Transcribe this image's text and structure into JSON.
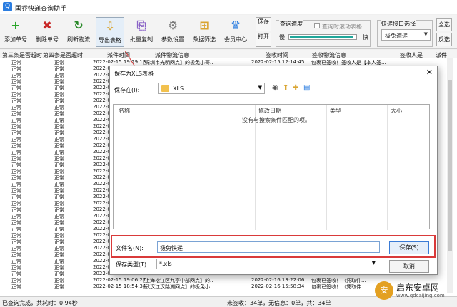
{
  "window": {
    "title": "国乔快递查询助手"
  },
  "toolbar": {
    "buttons": [
      {
        "label": "添加单号",
        "icon": "+",
        "icon_name": "plus-icon",
        "color": "#2aa52a"
      },
      {
        "label": "删除单号",
        "icon": "✖",
        "icon_name": "delete-x-icon",
        "color": "#c82828"
      },
      {
        "label": "刷新物流",
        "icon": "↻",
        "icon_name": "refresh-icon",
        "color": "#2a8a2a"
      },
      {
        "label": "导出表格",
        "icon": "⇩",
        "icon_name": "export-icon",
        "color": "#d9a430"
      },
      {
        "label": "批量复制",
        "icon": "⎘",
        "icon_name": "copy-icon",
        "color": "#8a63c7"
      },
      {
        "label": "参数设置",
        "icon": "⚙",
        "icon_name": "gear-icon",
        "color": "#777777"
      },
      {
        "label": "数据筛选",
        "icon": "⊞",
        "icon_name": "filter-icon",
        "color": "#d9a430"
      },
      {
        "label": "会员中心",
        "icon": "♛",
        "icon_name": "member-icon",
        "color": "#2b7de0"
      }
    ],
    "save": "保存",
    "open": "打开",
    "speed_group": "查询速度",
    "slow": "慢",
    "fast": "快",
    "scroll_checkbox": "查询时滚动表格",
    "speed_level": 0.95,
    "api_group": "快递接口选择",
    "api_selected": "极兔速递",
    "select_all": "全选",
    "invert": "反选"
  },
  "grid": {
    "headers": [
      "第三条是否超时",
      "第四条是否超时",
      "派件时间",
      "派件物流信息",
      "签收时间",
      "签收物流信息",
      "签收人是",
      "派件"
    ],
    "status_normal": "正常",
    "row1": {
      "time": "2022-02-15 19:29:13",
      "info": "【深圳市光明网点】的极兔小哥...",
      "sign_time": "2022-02-15 12:14:45",
      "sign_info": "包裹已签收！签收人是【本人签..."
    },
    "date_prefix": "2022-02-15",
    "row_last2": {
      "time": "2022-02-15 19:06:27",
      "info": "【上海松江区九亭中部网点】的...",
      "sign_time": "2022-02-16 13:22:06",
      "sign_info": "包裹已签收！（凭取件..."
    },
    "row_last": {
      "time": "2022-02-15 18:54:34",
      "info": "【武汉江汉路湖网点】的极兔小...",
      "sign_time": "2022-02-16 15:58:34",
      "sign_info": "包裹已签收！（凭取件..."
    }
  },
  "dialog": {
    "title": "保存为XLS表格",
    "save_in": "保存在(I):",
    "folder": "XLS",
    "col_name": "名称",
    "col_date": "修改日期",
    "col_type": "类型",
    "col_size": "大小",
    "empty": "没有与搜索条件匹配的项。",
    "filename_label": "文件名(N):",
    "filename": "极兔快递",
    "type_label": "保存类型(T):",
    "type_value": "*.xls",
    "save_btn": "保存(S)",
    "cancel_btn": "取消"
  },
  "statusbar": {
    "left": "已查询完成，共耗时：0.94秒",
    "right": "未签收：34单，无信息：0单，共：34单"
  },
  "watermark": {
    "title": "启东安卓网",
    "url": "www.qdcaijing.com"
  }
}
